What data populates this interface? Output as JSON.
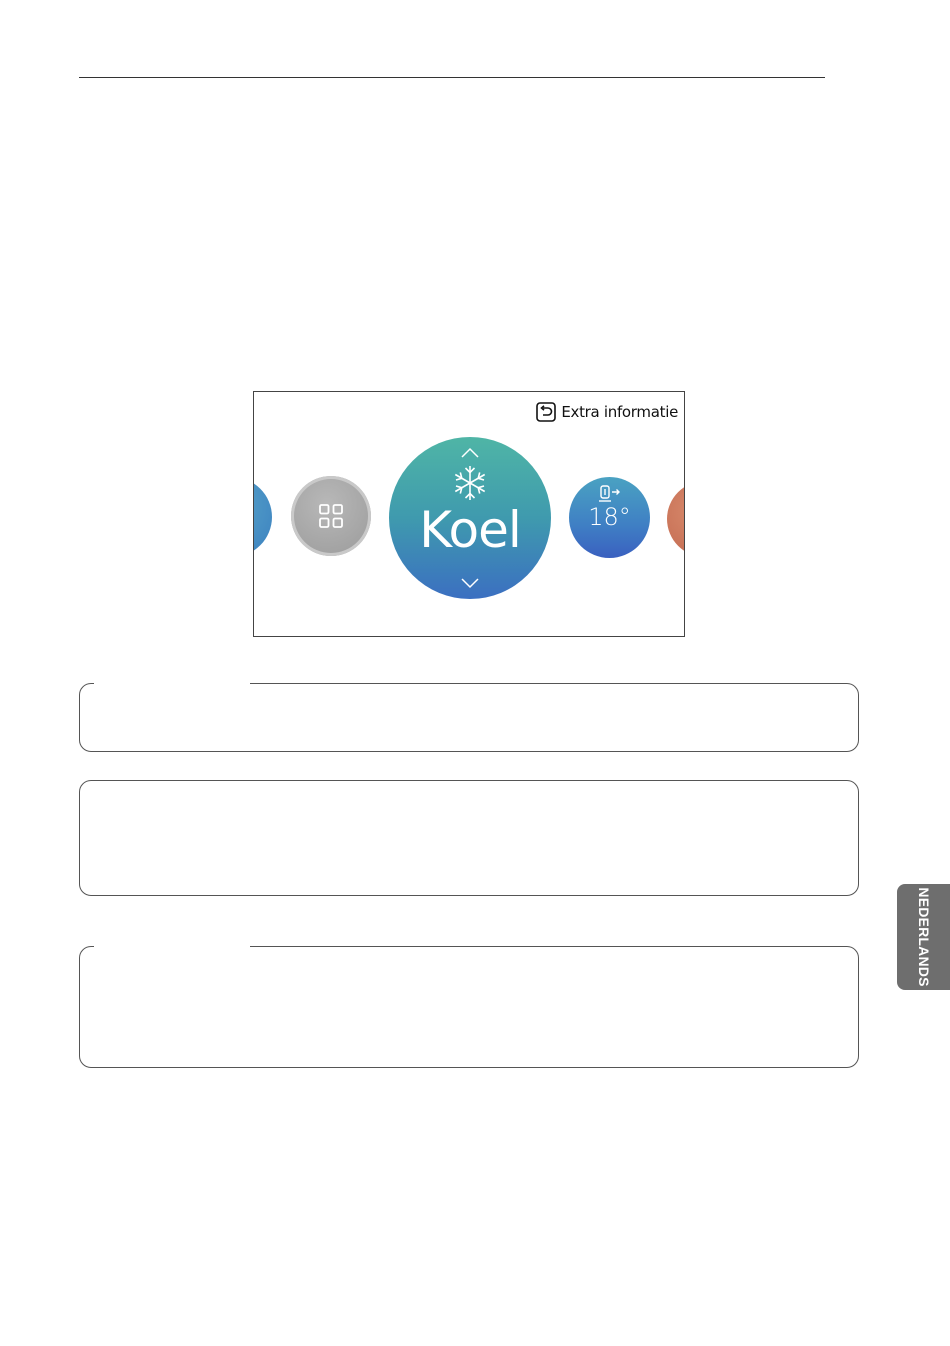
{
  "screen": {
    "info_button": {
      "label": "Extra informatie",
      "icon": "back-arrow-icon"
    },
    "carousel": {
      "main_mode": {
        "label": "Koel",
        "icon": "snowflake-icon"
      },
      "menu": {
        "icon": "grid-menu-icon"
      },
      "temperature": {
        "label": "18°",
        "icon": "water-temp-icon"
      }
    }
  },
  "side_tab": {
    "label": "NEDERLANDS"
  },
  "colors": {
    "main_top": "#4fb5a6",
    "main_bottom": "#3b6fc1",
    "menu_gray": "#a6a6a6",
    "right_edge": "#c96a50",
    "side_tab": "#6e6e6e"
  }
}
